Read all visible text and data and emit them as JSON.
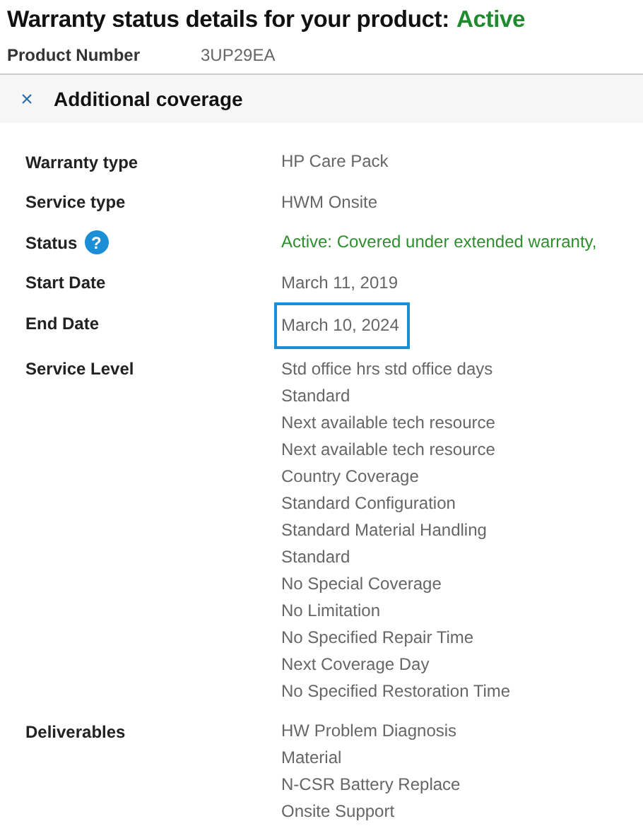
{
  "title": {
    "text": "Warranty status details for your product:",
    "status": "Active"
  },
  "product": {
    "label": "Product Number",
    "value": "3UP29EA"
  },
  "section": {
    "icon": "×",
    "title": "Additional coverage",
    "expanded": true
  },
  "rows": [
    {
      "kind": "plain",
      "label": "Warranty type",
      "values": [
        "HP Care Pack"
      ]
    },
    {
      "kind": "plain",
      "label": "Service type",
      "values": [
        "HWM Onsite"
      ]
    },
    {
      "kind": "status",
      "label": "Status",
      "help": "?",
      "values": [
        "Active: Covered under extended warranty,"
      ]
    },
    {
      "kind": "plain",
      "label": "Start Date",
      "values": [
        "March 11, 2019"
      ]
    },
    {
      "kind": "highlight",
      "label": "End Date",
      "values": [
        "March 10, 2024"
      ]
    },
    {
      "kind": "plain",
      "label": "Service Level",
      "values": [
        "Std office hrs std office days",
        "Standard",
        "Next available tech resource",
        "Next available tech resource",
        "Country Coverage",
        "Standard Configuration",
        "Standard Material Handling",
        "Standard",
        "No Special Coverage",
        "No Limitation",
        "No Specified Repair Time",
        "Next Coverage Day",
        "No Specified Restoration Time"
      ]
    },
    {
      "kind": "plain",
      "label": "Deliverables",
      "values": [
        "HW Problem Diagnosis",
        "Material",
        "N-CSR Battery Replace",
        "Onsite Support"
      ]
    }
  ]
}
